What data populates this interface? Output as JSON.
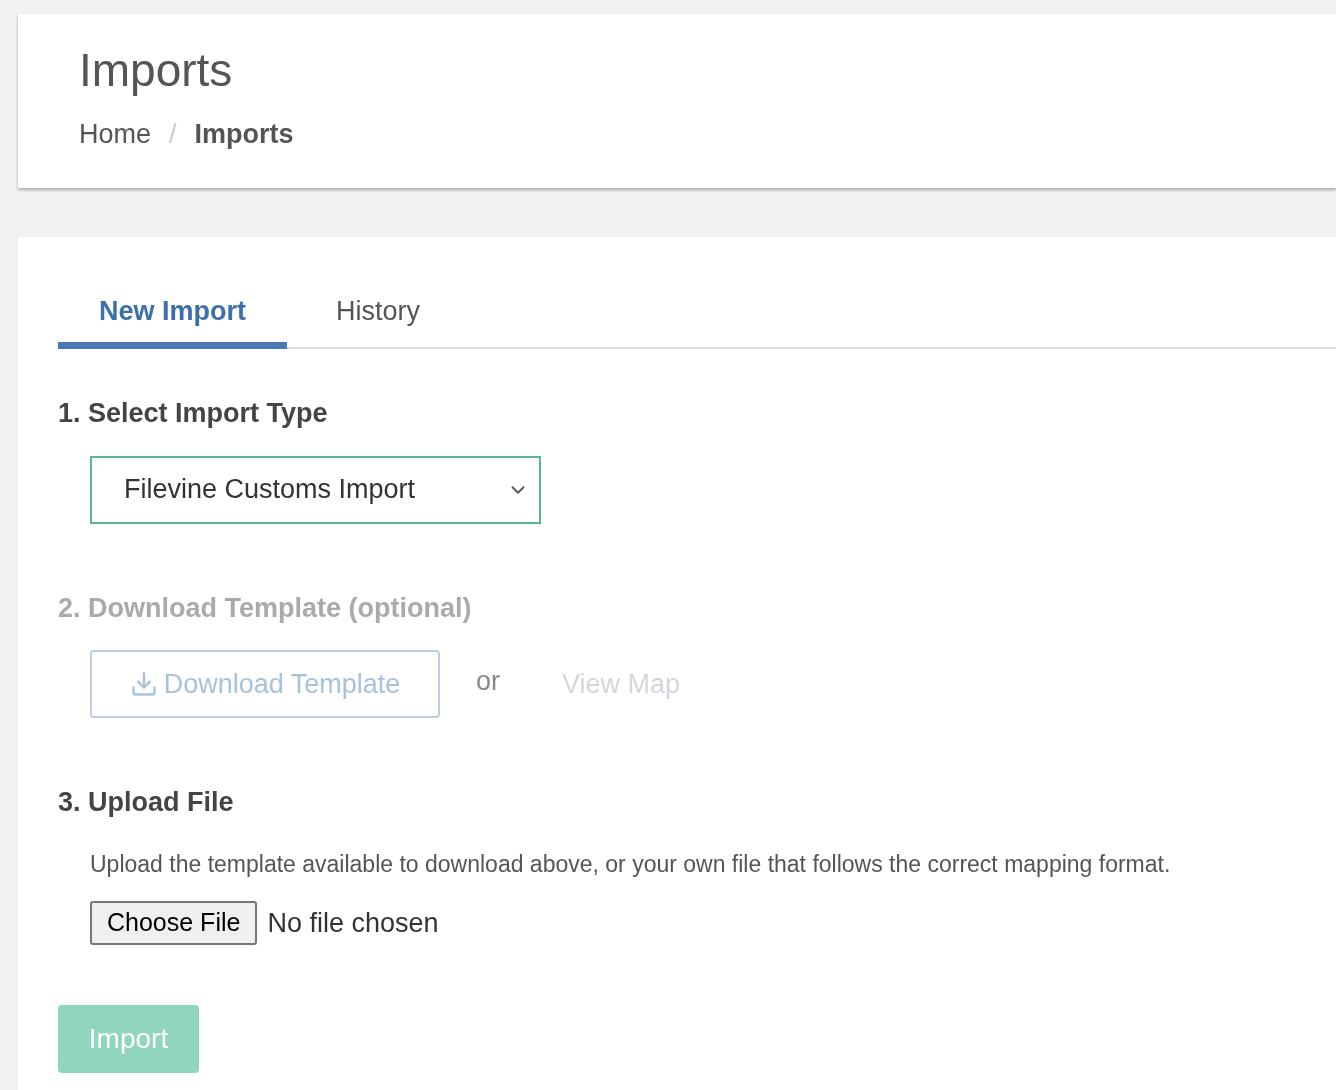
{
  "header": {
    "title": "Imports",
    "breadcrumb": [
      {
        "label": "Home",
        "current": false
      },
      {
        "label": "Imports",
        "current": true
      }
    ],
    "separator": "/"
  },
  "tabs": [
    {
      "label": "New Import",
      "selected": true
    },
    {
      "label": "History",
      "selected": false
    }
  ],
  "step_select": {
    "heading": "1. Select Import Type",
    "value": "Filevine Customs Import"
  },
  "step_template": {
    "heading": "2. Download Template (optional)",
    "disabled": true,
    "button": "Download Template",
    "or": "or",
    "link": "View Map"
  },
  "step_upload": {
    "heading": "3. Upload File",
    "description": "Upload the template available to download above, or your own file that follows the correct mapping format.",
    "choose_button": "Choose File",
    "file_status": "No file chosen"
  },
  "import_button": {
    "label": "Import",
    "disabled": true
  }
}
